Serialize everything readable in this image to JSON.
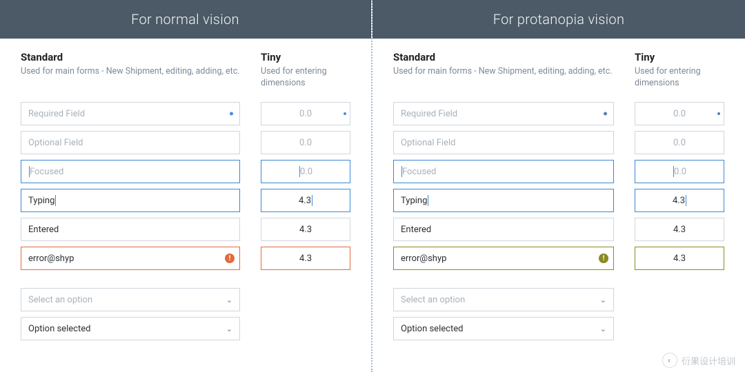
{
  "panels": {
    "normal": {
      "header": "For normal vision",
      "standard_title": "Standard",
      "standard_desc": "Used for main forms - New Shipment, editing, adding, etc.",
      "tiny_title": "Tiny",
      "tiny_desc": "Used for entering dimensions",
      "required_placeholder": "Required Field",
      "optional_placeholder": "Optional Field",
      "focused_placeholder": "Focused",
      "typing_value": "Typing",
      "entered_value": "Entered",
      "error_value": "error@shyp",
      "tiny_zero": "0.0",
      "tiny_val": "4.3",
      "select_placeholder": "Select an option",
      "select_selected": "Option selected"
    },
    "protan": {
      "header": "For protanopia vision",
      "standard_title": "Standard",
      "standard_desc": "Used for main forms - New Shipment, editing, adding, etc.",
      "tiny_title": "Tiny",
      "tiny_desc": "Used for entering dimensions",
      "required_placeholder": "Required Field",
      "optional_placeholder": "Optional Field",
      "focused_placeholder": "Focused",
      "typing_value": "Typing",
      "entered_value": "Entered",
      "error_value": "error@shyp",
      "tiny_zero": "0.0",
      "tiny_val": "4.3",
      "select_placeholder": "Select an option",
      "select_selected": "Option selected"
    }
  },
  "watermark": "衍果设计培训",
  "colors": {
    "header_bg": "#4b5a66",
    "focus_border_normal": "#3a87d6",
    "error_normal": "#e36a3d",
    "error_protan": "#8b8a1f",
    "required_dot_normal": "#418fde",
    "required_dot_protan": "#5a7db0"
  }
}
